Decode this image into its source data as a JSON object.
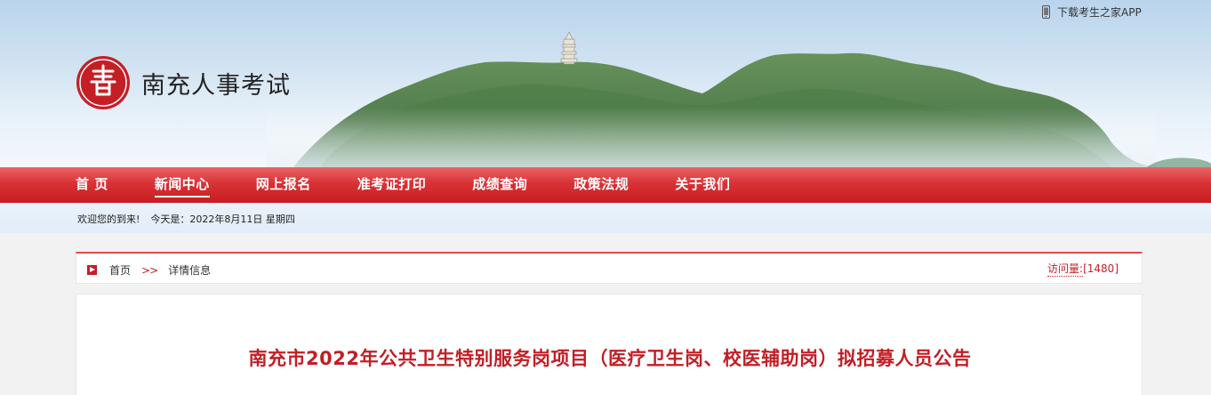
{
  "header": {
    "site_title": "南充人事考试",
    "logo_icon": "seal-logo-icon",
    "app_link": "下载考生之家APP",
    "app_icon": "phone-icon"
  },
  "nav": {
    "items": [
      {
        "label": "首 页",
        "active": false
      },
      {
        "label": "新闻中心",
        "active": true
      },
      {
        "label": "网上报名",
        "active": false
      },
      {
        "label": "准考证打印",
        "active": false
      },
      {
        "label": "成绩查询",
        "active": false
      },
      {
        "label": "政策法规",
        "active": false
      },
      {
        "label": "关于我们",
        "active": false
      }
    ]
  },
  "welcome": {
    "greeting": "欢迎您的到来!",
    "date_text": "今天是：2022年8月11日 星期四"
  },
  "breadcrumb": {
    "separator": ">>",
    "home": "首页",
    "current": "详情信息"
  },
  "visits": {
    "label": "访问量:",
    "count": "[1480]"
  },
  "article": {
    "title": "南充市2022年公共卫生特别服务岗项目（医疗卫生岗、校医辅助岗）拟招募人员公告"
  },
  "colors": {
    "brand_red": "#c71d22",
    "title_red": "#c21e24",
    "welcome_bg": "#e2edf8"
  }
}
